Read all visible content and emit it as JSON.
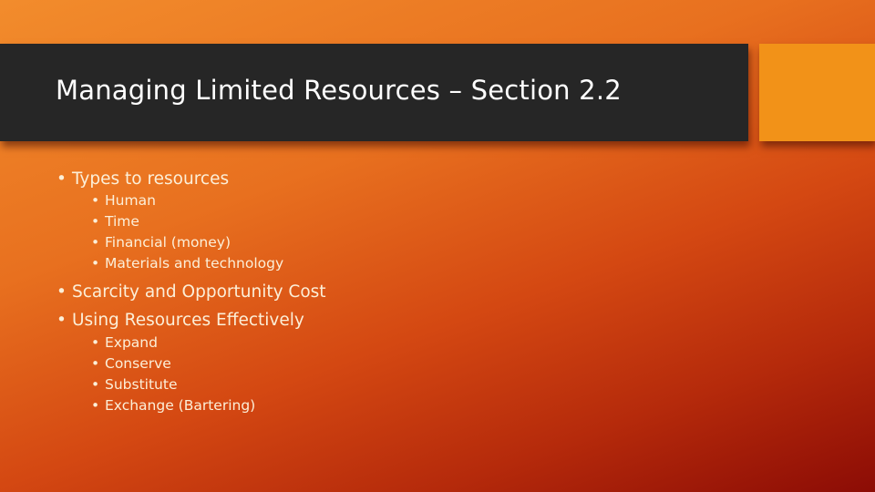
{
  "slide": {
    "title": "Managing Limited Resources – Section 2.2",
    "colors": {
      "title_bar": "#262626",
      "accent_square": "#f29218",
      "text": "#fcefd8",
      "background_start": "#f28c2c",
      "background_end": "#8c0c05"
    },
    "bullet_glyph": "•",
    "content": [
      {
        "text": "Types to resources",
        "children": [
          "Human",
          "Time",
          "Financial (money)",
          "Materials and technology"
        ]
      },
      {
        "text": "Scarcity and Opportunity Cost",
        "children": []
      },
      {
        "text": "Using Resources Effectively",
        "children": [
          "Expand",
          "Conserve",
          "Substitute",
          "Exchange (Bartering)"
        ]
      }
    ]
  }
}
